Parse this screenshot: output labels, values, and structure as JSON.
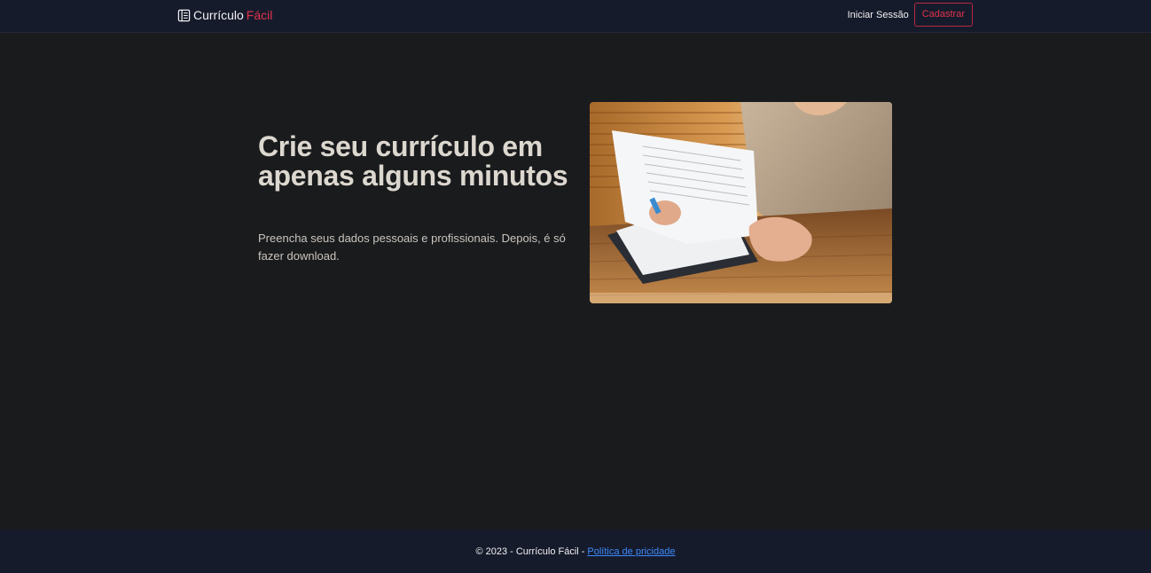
{
  "header": {
    "brand_main": "Currículo",
    "brand_accent": "Fácil",
    "brand_icon": "document-icon",
    "login_label": "Iniciar Sessão",
    "signup_label": "Cadastrar"
  },
  "hero": {
    "title": "Crie seu currículo em apenas alguns minutos",
    "text": "Preencha seus dados pessoais e profissionais. Depois, é só fazer download.",
    "image": "person-reading-resume-photo"
  },
  "footer": {
    "copyright": "© 2023",
    "separator": "-",
    "site_name": "Currículo Fácil",
    "separator2": "-",
    "privacy_label": "Política de pricidade"
  },
  "colors": {
    "nav_bg": "#161b2c",
    "page_bg": "#1a1b1d",
    "accent": "#e0334c",
    "link": "#3d8bfd"
  }
}
